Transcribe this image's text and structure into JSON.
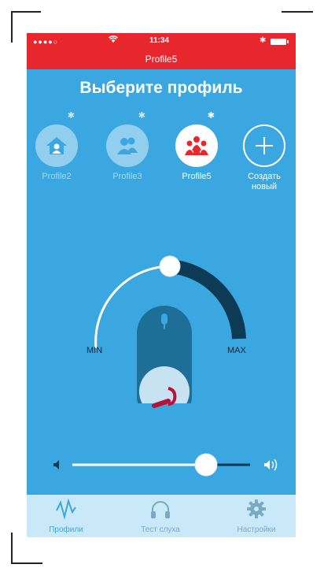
{
  "status": {
    "signal": "●●●●○",
    "wifi_icon": "wifi-icon",
    "time": "11:34",
    "bluetooth_icon": "bluetooth-icon",
    "battery_icon": "battery-icon",
    "active_profile": "Profile5"
  },
  "title": "Выберите профиль",
  "profiles": [
    {
      "label": "Profile2",
      "icon": "home-icon",
      "active": false
    },
    {
      "label": "Profile3",
      "icon": "people-icon",
      "active": false
    },
    {
      "label": "Profile5",
      "icon": "group-icon",
      "active": true
    },
    {
      "label": "Создать новый",
      "icon": "plus-icon",
      "active": false
    }
  ],
  "dial": {
    "min_label": "MIN",
    "max_label": "MAX",
    "level": 0.45,
    "mic_icon": "microphone-icon",
    "hearing_aid_icon": "hearing-aid-icon"
  },
  "volume": {
    "level": 0.73,
    "min_icon": "speaker-low-icon",
    "max_icon": "speaker-high-icon"
  },
  "tabs": [
    {
      "label": "Профили",
      "icon": "waveform-icon",
      "active": true
    },
    {
      "label": "Тест слуха",
      "icon": "headphones-icon",
      "active": false
    },
    {
      "label": "Настройки",
      "icon": "gear-icon",
      "active": false
    }
  ],
  "colors": {
    "accent": "#e8262e",
    "background": "#3aa7e0",
    "dial_dark": "#0d3a55",
    "tabbar": "#c9e8f8"
  }
}
